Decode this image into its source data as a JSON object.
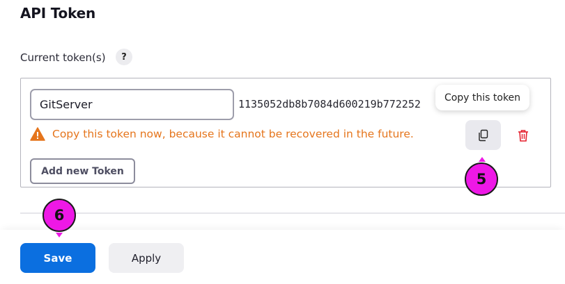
{
  "section": {
    "title": "API Token"
  },
  "tokens": {
    "label": "Current token(s)",
    "help_glyph": "?",
    "items": [
      {
        "name": "GitServer",
        "value": "1135052db8b7084d600219b772252"
      }
    ],
    "warning": "Copy this token now, because it cannot be recovered in the future.",
    "copy_tooltip": "Copy this token",
    "add_button": "Add new Token"
  },
  "footer": {
    "save": "Save",
    "apply": "Apply"
  },
  "markers": [
    "5",
    "6"
  ],
  "icons": {
    "warning": "warning-triangle-icon",
    "copy": "copy-icon",
    "delete": "trash-icon"
  },
  "colors": {
    "primary": "#0b6fe0",
    "warning": "#e5751c",
    "danger": "#e5202e",
    "marker": "#ee18e6"
  }
}
